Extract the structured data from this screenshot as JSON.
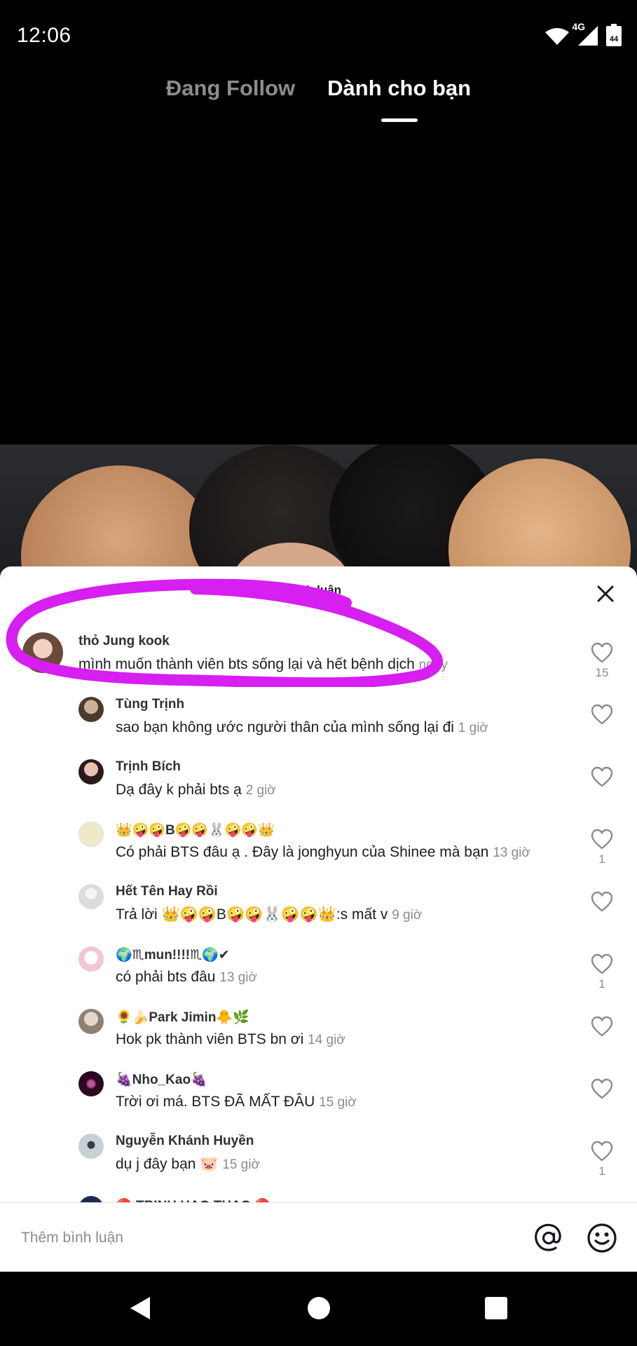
{
  "status_bar": {
    "time": "12:06",
    "network": "4G",
    "battery": "44"
  },
  "top_tabs": [
    {
      "label": "Đang Follow",
      "active": false
    },
    {
      "label": "Dành cho bạn",
      "active": true
    }
  ],
  "sheet": {
    "title": "ình luận"
  },
  "comments": [
    {
      "name": "thỏ Jung kook",
      "text": "mình muốn thành viên bts sống lại và hết bệnh dịch",
      "time": "ngày",
      "likes": "15",
      "avatar_color": "#c9a58f"
    },
    {
      "name": "Tùng Trịnh",
      "text": "sao bạn không ước người thân của mình sống lại đi",
      "time": "1 giờ",
      "likes": "",
      "avatar_color": "#5a4a3a"
    },
    {
      "name": "Trịnh Bích",
      "text": "Dạ đây k phải bts ạ",
      "time": "2 giờ",
      "likes": "",
      "avatar_color": "#6b3a3f"
    },
    {
      "name": "👑🤪🤪B🤪🤪🐰🤪🤪👑",
      "text": "Có phải BTS đâu ạ . Đây là jonghyun của Shinee mà bạn",
      "time": "13 giờ",
      "likes": "1",
      "avatar_color": "#e9e3c8"
    },
    {
      "name": "Hết Tên Hay Rồi",
      "text": "Trả lời 👑🤪🤪B🤪🤪🐰🤪🤪👑:s mất v",
      "time": "9 giờ",
      "likes": "",
      "avatar_color": "#d9d9db"
    },
    {
      "name": "🌍♏mun!!!!♏🌍✔",
      "text": "có phải bts đâu",
      "time": "13 giờ",
      "likes": "1",
      "avatar_color": "#f3d6de"
    },
    {
      "name": "🌻🍌Park Jimin🐥🌿",
      "text": "Hok pk thành viên BTS bn ơi",
      "time": "14 giờ",
      "likes": "",
      "avatar_color": "#b5a89c"
    },
    {
      "name": "🍇Nho_Kao🍇",
      "text": "Trời ơi má. BTS ĐÃ MẤT ĐÂU",
      "time": "15 giờ",
      "likes": "",
      "avatar_color": "#3a1030"
    },
    {
      "name": "Nguyễn Khánh Huyền",
      "text": "dụ j đây bạn 🐷",
      "time": "15 giờ",
      "likes": "1",
      "avatar_color": "#b7c2c8"
    },
    {
      "name": "🔴 TRỊNH HẠO THẠC 🔴",
      "text": "",
      "time": "",
      "likes": "",
      "avatar_color": "#1d2a55"
    }
  ],
  "input": {
    "placeholder": "Thêm bình luận"
  },
  "icons": {
    "close": "close-icon",
    "heart": "heart-icon",
    "mention": "at-icon",
    "emoji": "emoji-icon",
    "back": "back-triangle-icon",
    "home": "home-circle-icon",
    "recents": "recents-square-icon"
  },
  "highlight_color": "#d61ff0"
}
